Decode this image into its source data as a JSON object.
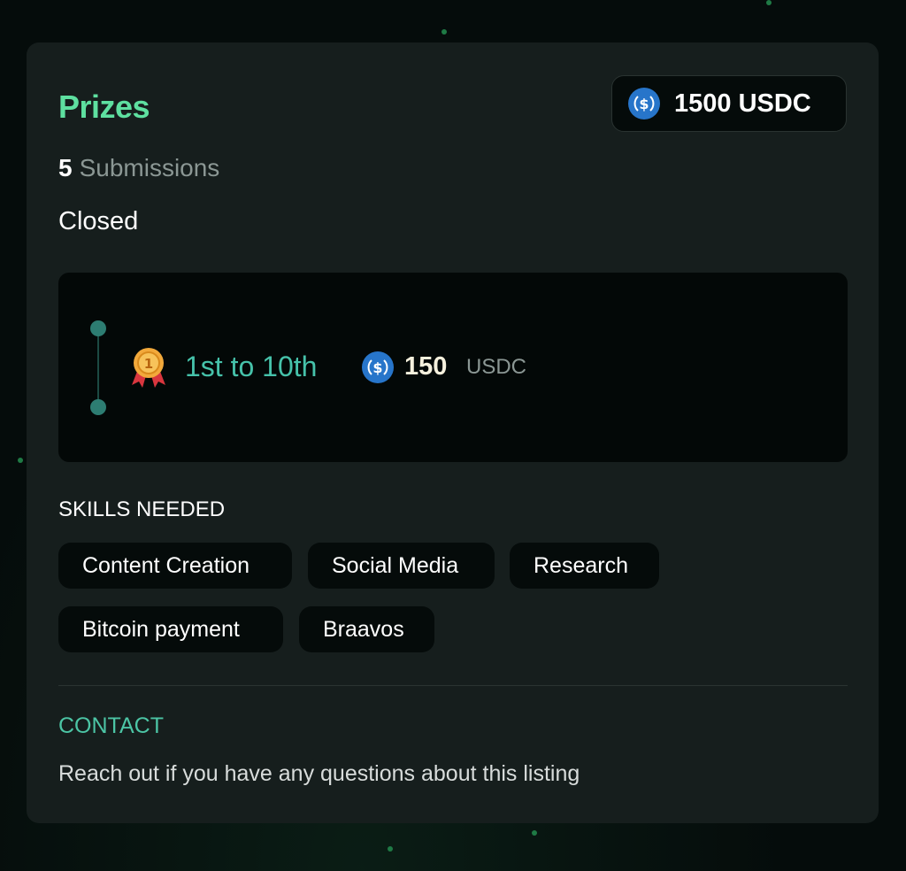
{
  "prizes": {
    "title": "Prizes",
    "total": {
      "icon": "usdc-icon",
      "value": "1500 USDC"
    },
    "submissions": {
      "count": "5",
      "label": "Submissions"
    },
    "status": "Closed",
    "tiers": [
      {
        "icon": "medal-icon",
        "rank": "1st to 10th",
        "amount": "150",
        "unit": "USDC"
      }
    ]
  },
  "skills": {
    "heading": "SKILLS NEEDED",
    "items": [
      "Content Creation",
      "Social Media",
      "Research",
      "Bitcoin payment",
      "Braavos"
    ]
  },
  "contact": {
    "heading": "CONTACT",
    "text": "Reach out if you have any questions about this listing"
  },
  "colors": {
    "background": "#050c0b",
    "card": "#161e1d",
    "accent_green": "#5ee0a0",
    "accent_teal": "#46c2aa",
    "usdc_blue": "#2775ca"
  }
}
